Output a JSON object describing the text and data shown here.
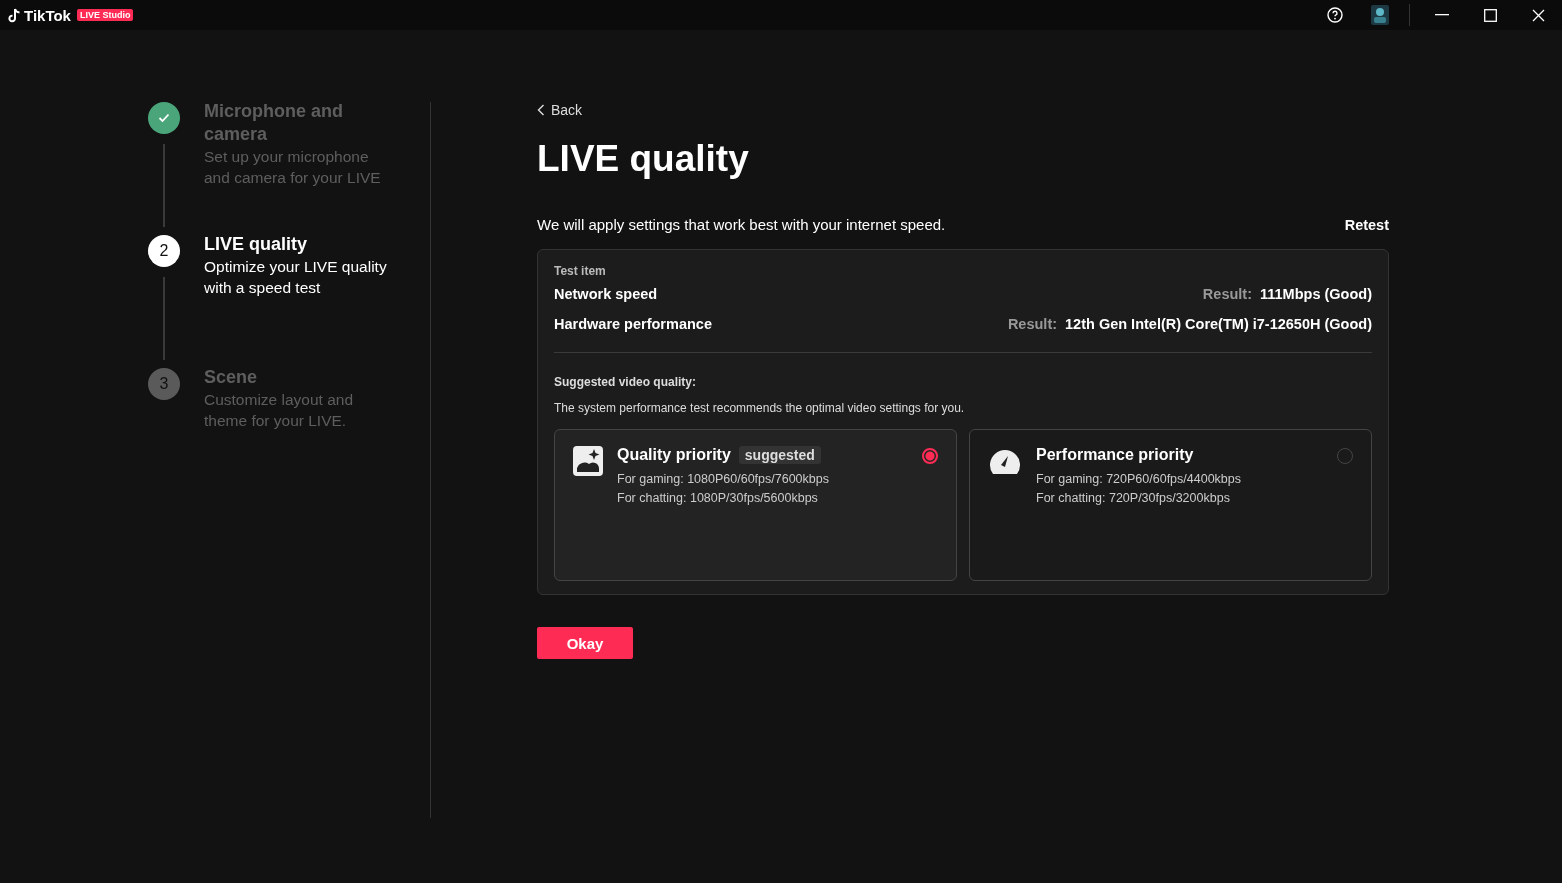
{
  "app": {
    "logo": "TikTok",
    "badge": "LIVE Studio"
  },
  "steps": [
    {
      "completed": true,
      "current": false,
      "title": "Microphone and camera",
      "description": "Set up your microphone and camera for your LIVE"
    },
    {
      "number": "2",
      "completed": false,
      "current": true,
      "title": "LIVE quality",
      "description": "Optimize your LIVE quality with a speed test"
    },
    {
      "number": "3",
      "completed": false,
      "current": false,
      "title": "Scene",
      "description": "Customize layout and theme for your LIVE."
    }
  ],
  "back": "Back",
  "title": "LIVE quality",
  "intro": "We will apply settings that work best with your internet speed.",
  "retest": "Retest",
  "test": {
    "header": "Test item",
    "rows": [
      {
        "item": "Network speed",
        "result_label": "Result:",
        "result": "111Mbps (Good)"
      },
      {
        "item": "Hardware performance",
        "result_label": "Result:",
        "result": "12th Gen Intel(R) Core(TM) i7-12650H (Good)"
      }
    ]
  },
  "suggested_heading": "Suggested video quality:",
  "suggested_note": "The system performance test recommends the optimal video settings for you.",
  "options": [
    {
      "kind": "quality",
      "title": "Quality priority",
      "tag": "suggested",
      "gaming": "For gaming: 1080P60/60fps/7600kbps",
      "chatting": "For chatting: 1080P/30fps/5600kbps",
      "selected": true
    },
    {
      "kind": "performance",
      "title": "Performance priority",
      "gaming": "For gaming: 720P60/60fps/4400kbps",
      "chatting": "For chatting: 720P/30fps/3200kbps",
      "selected": false
    }
  ],
  "okay": "Okay"
}
